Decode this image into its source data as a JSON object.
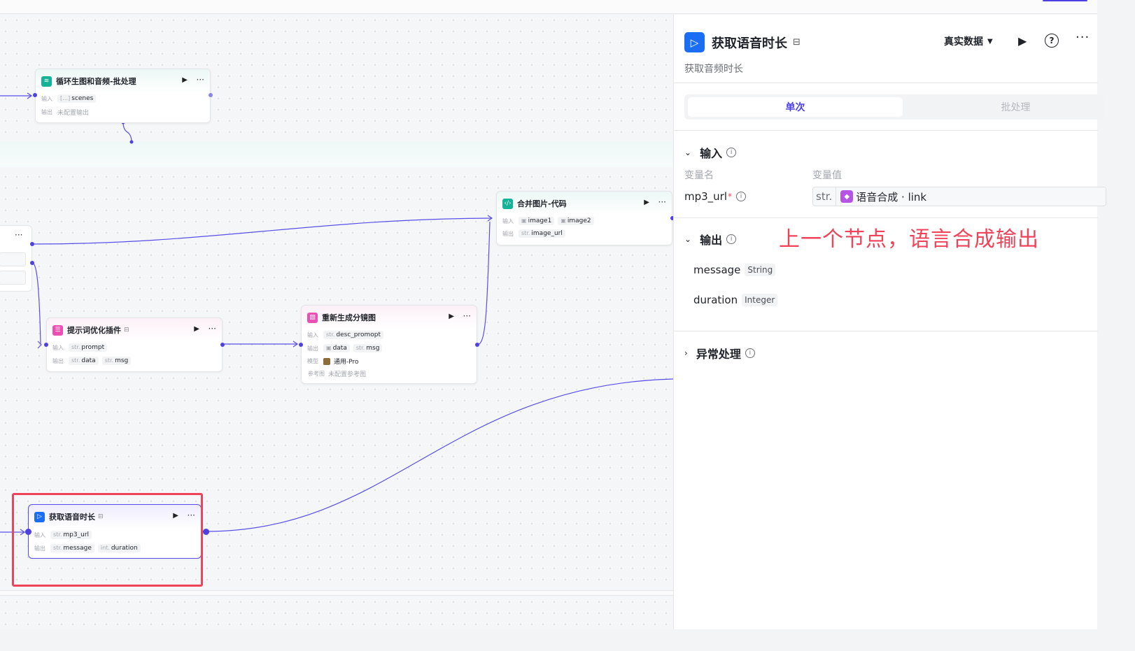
{
  "canvas": {
    "nodes": {
      "batch": {
        "title": "循环生图和音频-批处理",
        "in_label": "输入",
        "in_tag_type": "[…]",
        "in_tag": "scenes",
        "out_label": "输出",
        "out_value": "未配置输出"
      },
      "merge": {
        "title": "合并图片-代码",
        "in_label": "输入",
        "in_tag1": "image1",
        "in_tag2": "image2",
        "out_label": "输出",
        "out_tag_type": "str.",
        "out_tag": "image_url"
      },
      "prompt": {
        "title": "提示词优化插件",
        "in_label": "输入",
        "in_tag_type": "str.",
        "in_tag": "prompt",
        "out_label": "输出",
        "out_tag1_type": "str.",
        "out_tag1": "data",
        "out_tag2_type": "str.",
        "out_tag2": "msg"
      },
      "regen": {
        "title": "重新生成分镜图",
        "in_label": "输入",
        "in_tag_type": "str.",
        "in_tag": "desc_promopt",
        "out_label": "输出",
        "out_tag1": "data",
        "out_tag2_type": "str.",
        "out_tag2": "msg",
        "model_label": "模型",
        "model_value": "通用-Pro",
        "ref_label": "参考图",
        "ref_value": "未配置参考图"
      },
      "duration": {
        "title": "获取语音时长",
        "in_label": "输入",
        "in_tag_type": "str.",
        "in_tag": "mp3_url",
        "out_label": "输出",
        "out_tag1_type": "str.",
        "out_tag1": "message",
        "out_tag2_type": "int.",
        "out_tag2": "duration"
      }
    }
  },
  "panel": {
    "title": "获取语音时长",
    "subtitle": "获取音频时长",
    "data_mode": "真实数据",
    "tabs": [
      "单次",
      "批处理"
    ],
    "input_section": "输入",
    "col_name": "变量名",
    "col_value": "变量值",
    "input_var": {
      "name": "mp3_url",
      "required_mark": "*",
      "type_prefix": "str.",
      "value": "语音合成 · link"
    },
    "annotation": "上一个节点，语言合成输出",
    "output_section": "输出",
    "outputs": [
      {
        "name": "message",
        "type": "String"
      },
      {
        "name": "duration",
        "type": "Integer"
      }
    ],
    "exception_section": "异常处理"
  },
  "colors": {
    "accent": "#4e40e5",
    "highlight": "#f0435a",
    "brand_blue": "#1b6ef3"
  }
}
